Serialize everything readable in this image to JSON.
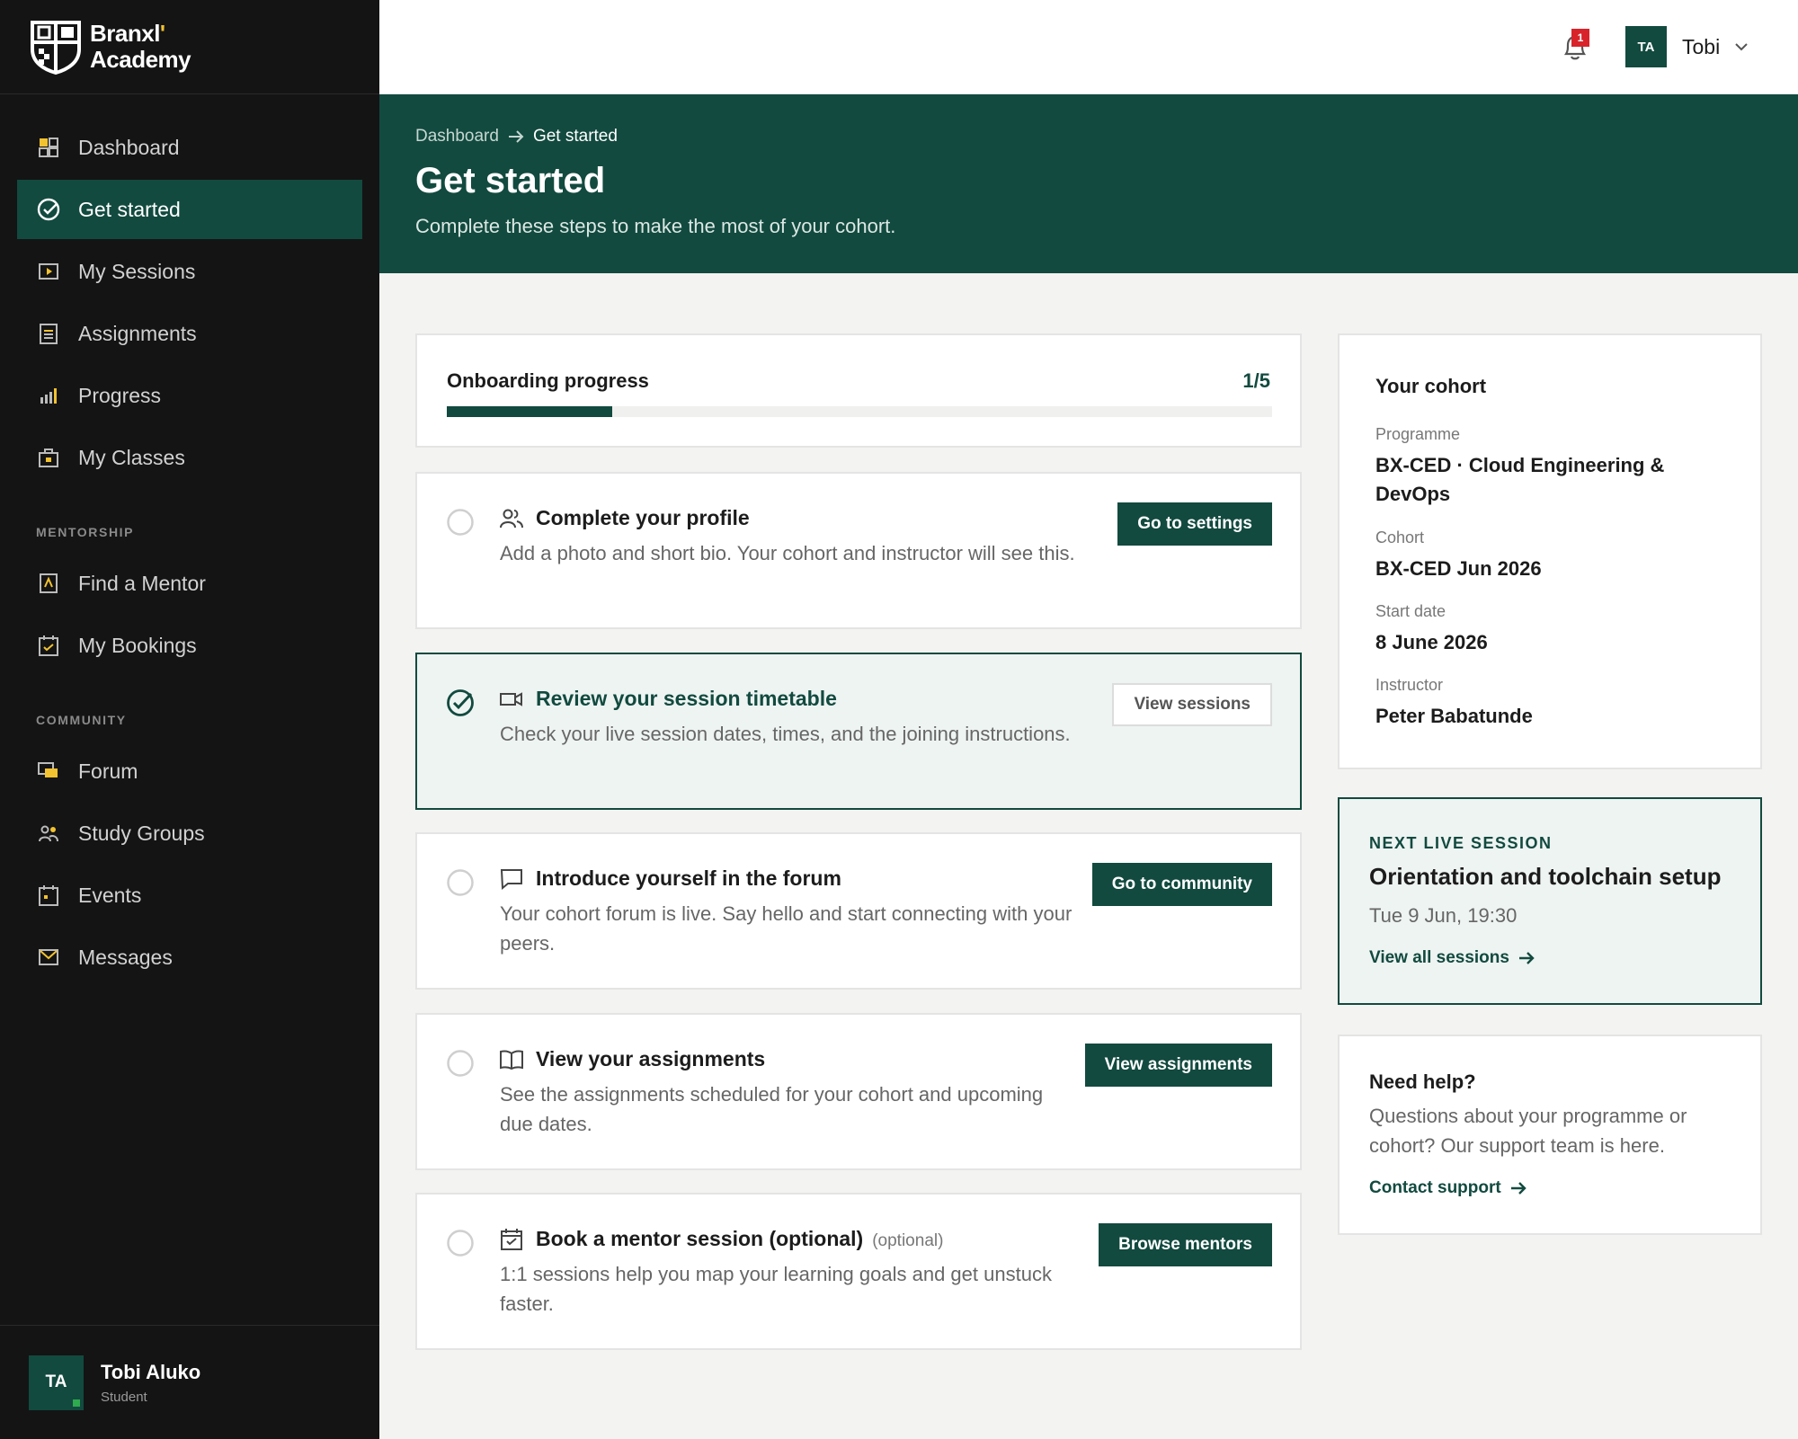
{
  "brand": {
    "name_line1": "Branxl",
    "name_line2": "Academy"
  },
  "sidebar": {
    "nav": [
      {
        "label": "Dashboard",
        "icon": "dashboard-icon"
      },
      {
        "label": "Get started",
        "icon": "check-circle-icon",
        "active": true
      },
      {
        "label": "My Sessions",
        "icon": "play-icon"
      },
      {
        "label": "Assignments",
        "icon": "clipboard-icon"
      },
      {
        "label": "Progress",
        "icon": "bar-chart-icon"
      },
      {
        "label": "My Classes",
        "icon": "briefcase-icon"
      }
    ],
    "mentorship_heading": "MENTORSHIP",
    "mentorship": [
      {
        "label": "Find a Mentor",
        "icon": "mentor-icon"
      },
      {
        "label": "My Bookings",
        "icon": "calendar-check-icon"
      }
    ],
    "community_heading": "COMMUNITY",
    "community": [
      {
        "label": "Forum",
        "icon": "chat-icon"
      },
      {
        "label": "Study Groups",
        "icon": "group-icon"
      },
      {
        "label": "Events",
        "icon": "calendar-icon"
      },
      {
        "label": "Messages",
        "icon": "mail-icon"
      }
    ],
    "user": {
      "initials": "TA",
      "name": "Tobi Aluko",
      "role": "Student"
    }
  },
  "topbar": {
    "notification_count": "1",
    "user_initials": "TA",
    "user_name": "Tobi"
  },
  "hero": {
    "breadcrumb": [
      "Dashboard",
      "Get started"
    ],
    "title": "Get started",
    "subtitle": "Complete these steps to make the most of your cohort."
  },
  "progress": {
    "title": "Onboarding progress",
    "count": "1/5",
    "fraction": 0.2
  },
  "steps": [
    {
      "title": "Complete your profile",
      "desc": "Add a photo and short bio. Your cohort and instructor will see this.",
      "button": "Go to settings",
      "done": false,
      "icon": "users-icon"
    },
    {
      "title": "Review your session timetable",
      "desc": "Check your live session dates, times, and the joining instructions.",
      "button": "View sessions",
      "done": true,
      "icon": "video-icon"
    },
    {
      "title": "Introduce yourself in the forum",
      "desc": "Your cohort forum is live. Say hello and start connecting with your peers.",
      "button": "Go to community",
      "done": false,
      "icon": "message-icon"
    },
    {
      "title": "View your assignments",
      "desc": "See the assignments scheduled for your cohort and upcoming due dates.",
      "button": "View assignments",
      "done": false,
      "icon": "book-icon"
    },
    {
      "title": "Book a mentor session (optional)",
      "optional": "(optional)",
      "desc": "1:1 sessions help you map your learning goals and get unstuck faster.",
      "button": "Browse mentors",
      "done": false,
      "icon": "calendar-check-icon"
    }
  ],
  "cohort": {
    "title": "Your cohort",
    "programme_label": "Programme",
    "programme": "BX-CED · Cloud Engineering & DevOps",
    "cohort_label": "Cohort",
    "cohort": "BX-CED Jun 2026",
    "start_label": "Start date",
    "start": "8 June 2026",
    "instructor_label": "Instructor",
    "instructor": "Peter Babatunde"
  },
  "next_session": {
    "label": "NEXT LIVE SESSION",
    "title": "Orientation and toolchain setup",
    "time": "Tue 9 Jun, 19:30",
    "link": "View all sessions"
  },
  "help": {
    "title": "Need help?",
    "desc": "Questions about your programme or cohort? Our support team is here.",
    "link": "Contact support"
  },
  "colors": {
    "brand_green": "#124a3f",
    "sidebar_bg": "#141414",
    "accent_yellow": "#f2c230",
    "badge_red": "#d8232a"
  }
}
